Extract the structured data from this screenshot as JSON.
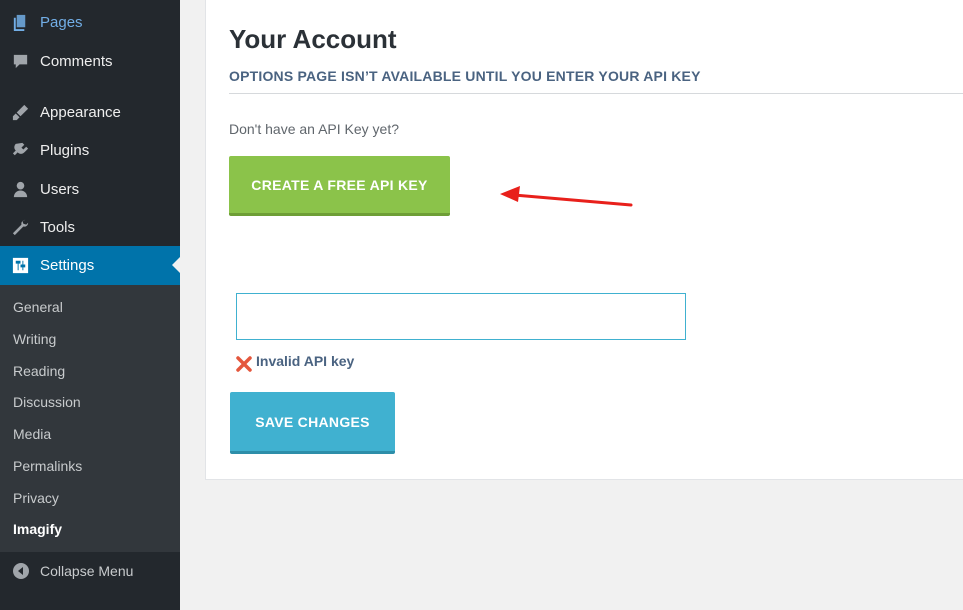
{
  "sidebar": {
    "items": [
      {
        "label": "Pages",
        "icon": "pages-icon"
      },
      {
        "label": "Comments",
        "icon": "comments-icon"
      },
      {
        "label": "Appearance",
        "icon": "appearance-icon"
      },
      {
        "label": "Plugins",
        "icon": "plugins-icon"
      },
      {
        "label": "Users",
        "icon": "users-icon"
      },
      {
        "label": "Tools",
        "icon": "tools-icon"
      },
      {
        "label": "Settings",
        "icon": "settings-icon"
      }
    ],
    "submenu": [
      "General",
      "Writing",
      "Reading",
      "Discussion",
      "Media",
      "Permalinks",
      "Privacy",
      "Imagify"
    ],
    "current_submenu": "Imagify",
    "collapse_label": "Collapse Menu"
  },
  "main": {
    "title": "Your Account",
    "subtitle": "OPTIONS PAGE ISN’T AVAILABLE UNTIL YOU ENTER YOUR API KEY",
    "prompt": "Don't have an API Key yet?",
    "create_button": "CREATE A FREE API KEY",
    "api_key_value": "",
    "error_message": "Invalid API key",
    "save_button": "SAVE CHANGES"
  },
  "colors": {
    "sidebar_bg": "#23282d",
    "submenu_bg": "#32373c",
    "active_blue": "#0073aa",
    "create_green": "#8bc34a",
    "save_blue": "#40b1d0",
    "annotation_red": "#e8201b",
    "error_red": "#e4573d"
  }
}
